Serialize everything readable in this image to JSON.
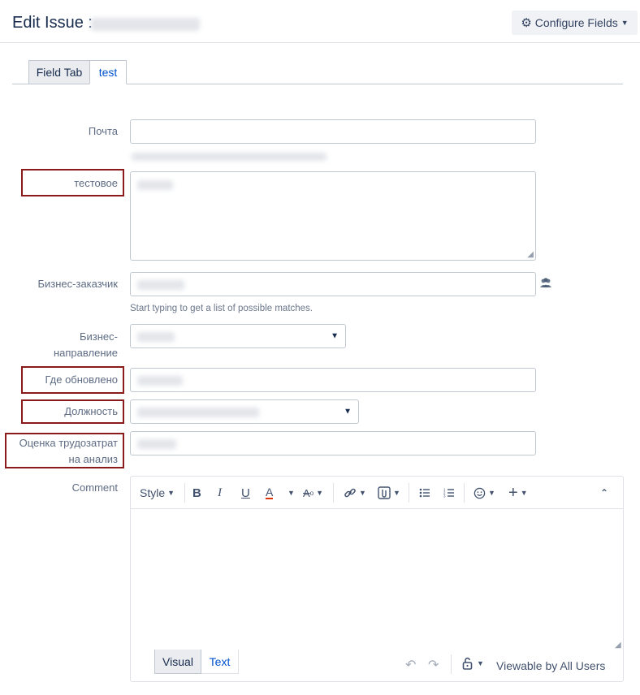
{
  "header": {
    "title": "Edit Issue :",
    "configure_fields": "Configure Fields"
  },
  "tabs": [
    {
      "label": "Field Tab"
    },
    {
      "label": "test"
    }
  ],
  "fields": {
    "pochta": {
      "label": "Почта"
    },
    "testovoe": {
      "label": "тестовое"
    },
    "biznes_zakazchik": {
      "label": "Бизнес-заказчик",
      "hint": "Start typing to get a list of possible matches."
    },
    "biznes_napravlenie": {
      "label_line1": "Бизнес-",
      "label_line2": "направление"
    },
    "gde_obnovleno": {
      "label": "Где обновлено"
    },
    "dolzhnost": {
      "label": "Должность"
    },
    "ocenka": {
      "label_line1": "Оценка трудозатрат",
      "label_line2": "на анализ"
    },
    "comment": {
      "label": "Comment"
    }
  },
  "editor": {
    "style_label": "Style",
    "bottom_tabs": {
      "visual": "Visual",
      "text": "Text"
    },
    "visibility": "Viewable by All Users"
  },
  "colors": {
    "accent": "#0052cc",
    "highlight_border": "#8b1a1a",
    "text_color_red": "#de350b"
  }
}
